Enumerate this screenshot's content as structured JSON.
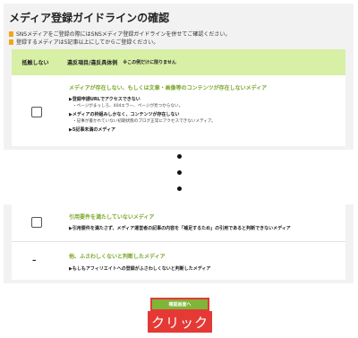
{
  "title": "メディア登録ガイドラインの確認",
  "notes": {
    "line1_before": "SNSメディアをご登録の際にはSNSメディア登録ガイドラインを併せてご確認ください。",
    "line2": "登録するメディアは5記事以上にしてからご登録ください。"
  },
  "table": {
    "col1": "抵触しない",
    "col2": "違反項目/違反具体例",
    "col2_note": "※この例だけに限りません"
  },
  "rows": [
    {
      "category": "メディアが存在しない、もしくは文章・画像等のコンテンツが存在しないメディア",
      "items": [
        "▶登録申請URLでアクセスできない",
        "・ページがまっしろ、404エラー、ページが見つからない。",
        "▶メディアの枠組みしかなく、コンテンツが存在しない",
        "・記事が書かれていない初期状態のブログ正常にアクセスできないメディア。",
        "▶5記事未満のメディア"
      ]
    },
    {
      "category": "引用要件を満たしていないメディア",
      "items": [
        "▶引用要件を満たさず、メディア運営者の記事の内容を「補足するため」の引用であると判断できないメディア"
      ]
    },
    {
      "category": "他、ふさわしくないと判断したメディア",
      "items": [
        "▶もしもアフィリエイトへの登録がふさわしくないと判断したメディア"
      ]
    }
  ],
  "row3_mark": "–",
  "confirm_button": "確認画面へ",
  "click_label": "クリック",
  "colors": {
    "accent": "#7fb539",
    "header": "#d8efa6",
    "highlight": "#e53935"
  }
}
